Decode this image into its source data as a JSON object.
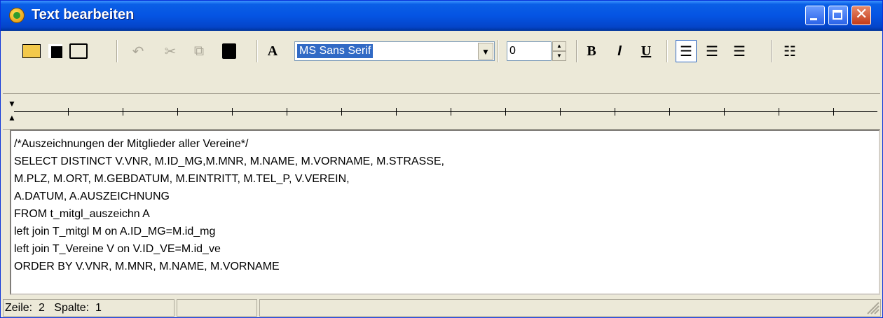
{
  "window": {
    "title": "Text bearbeiten"
  },
  "toolbar": {
    "font_name": "MS Sans Serif",
    "font_size": "0",
    "bold_label": "B",
    "italic_label": "I",
    "underline_label": "U",
    "font_label": "A"
  },
  "editor": {
    "lines": [
      "/*Auszeichnungen der Mitglieder aller Vereine*/",
      "SELECT DISTINCT V.VNR, M.ID_MG,M.MNR, M.NAME, M.VORNAME, M.STRASSE,",
      "M.PLZ, M.ORT, M.GEBDATUM, M.EINTRITT, M.TEL_P, V.VEREIN,",
      "A.DATUM, A.AUSZEICHNUNG",
      "FROM t_mitgl_auszeichn A",
      "left join T_mitgl M on A.ID_MG=M.id_mg",
      "left join T_Vereine V on V.ID_VE=M.id_ve",
      "ORDER BY V.VNR, M.MNR, M.NAME, M.VORNAME"
    ]
  },
  "status": {
    "line_label": "Zeile:",
    "line_value": "2",
    "col_label": "Spalte:",
    "col_value": "1"
  }
}
